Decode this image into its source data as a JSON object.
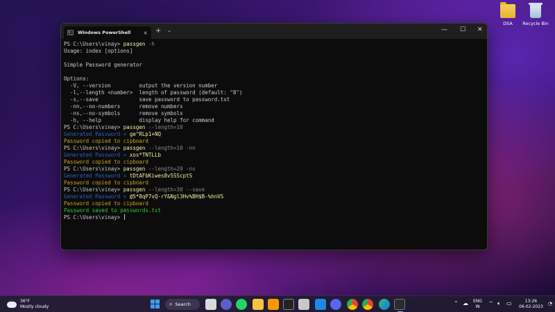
{
  "desktop": {
    "icons": [
      {
        "label": "DSA"
      },
      {
        "label": "Recycle Bin"
      }
    ]
  },
  "window": {
    "tab_title": "Windows PowerShell",
    "tab_icon_glyph": ">_",
    "close_glyph": "×",
    "newtab_glyph": "+",
    "dropdown_glyph": "⌄",
    "minimize_glyph": "—",
    "maximize_glyph": "☐",
    "window_close_glyph": "✕"
  },
  "terminal": {
    "prompt": "PS C:\\Users\\vinay> ",
    "lines": [
      {
        "type": "cmd",
        "command": "passgen",
        "args": " -h"
      },
      {
        "type": "text",
        "text": "Usage: index [options]"
      },
      {
        "type": "text",
        "text": ""
      },
      {
        "type": "text",
        "text": "Simple Password generator"
      },
      {
        "type": "text",
        "text": ""
      },
      {
        "type": "text",
        "text": "Options:"
      },
      {
        "type": "text",
        "text": "  -V, --version         output the version number"
      },
      {
        "type": "text",
        "text": "  -l,--length <number>  length of password (default: \"8\")"
      },
      {
        "type": "text",
        "text": "  -s,--save             save password to password.txt"
      },
      {
        "type": "text",
        "text": "  -nn,--no-numbers      remove numbers"
      },
      {
        "type": "text",
        "text": "  -ns,--no-symbols      remove symbols"
      },
      {
        "type": "text",
        "text": "  -h, --help            display help for command"
      },
      {
        "type": "cmd",
        "command": "passgen",
        "args": " --length=10"
      },
      {
        "type": "gen",
        "label": "Generated Password = ",
        "password": "ge^RLp1+NQ"
      },
      {
        "type": "copied",
        "text": "Password copied to cipboard"
      },
      {
        "type": "cmd",
        "command": "passgen",
        "args": " --length=10 -nn"
      },
      {
        "type": "gen",
        "label": "Generated Password = ",
        "password": "xos*TNTLLb"
      },
      {
        "type": "copied",
        "text": "Password copied to cipboard"
      },
      {
        "type": "cmd",
        "command": "passgen",
        "args": " --length=20 -ns"
      },
      {
        "type": "gen",
        "label": "Generated Password = ",
        "password": "tDtAFbKiwes8v5SScptS"
      },
      {
        "type": "copied",
        "text": "Password copied to cipboard"
      },
      {
        "type": "cmd",
        "command": "passgen",
        "args": " --length=30 --save"
      },
      {
        "type": "gen",
        "label": "Generated Password = ",
        "password": "@5*8qP7vQ-rY&Ngl3Hv%BH$B-%hnVS"
      },
      {
        "type": "copied",
        "text": "Password copied to cipboard"
      },
      {
        "type": "saved",
        "text": "Password saved to passwords.txt"
      },
      {
        "type": "prompt_only"
      }
    ]
  },
  "taskbar": {
    "weather_temp": "36°F",
    "weather_desc": "Mostly cloudy",
    "search_label": "Search",
    "apps": [
      "file-explorer-view",
      "teams",
      "whatsapp",
      "file-explorer",
      "sublime-text",
      "terminal-app",
      "vscode",
      "discord",
      "chrome",
      "chrome-alt",
      "edge",
      "windows-terminal"
    ],
    "lang_top": "ENG",
    "lang_bottom": "IN",
    "time": "13:26",
    "date": "06-02-2023"
  },
  "colors": {
    "command": "#f2f0a8",
    "generated_label": "#2d5fc4",
    "copied": "#c9a224",
    "saved": "#2ecc40"
  }
}
